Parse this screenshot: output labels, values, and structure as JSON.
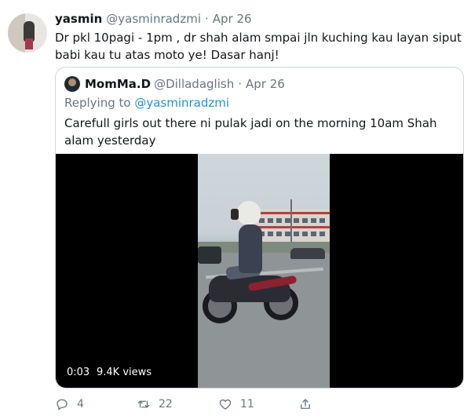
{
  "tweet": {
    "author_name": "yasmin",
    "handle": "@yasminradzmi",
    "separator": "·",
    "date": "Apr 26",
    "text": "Dr pkl 10pagi - 1pm , dr shah alam smpai jln kuching kau layan siput babi kau tu atas moto ye! Dasar hanj!"
  },
  "quoted": {
    "author_name": "MomMa.D",
    "handle": "@Dilladaglish",
    "separator": "·",
    "date": "Apr 26",
    "replying_prefix": "Replying to ",
    "replying_handle": "@yasminradzmi",
    "text": "Carefull girls out there ni pulak jadi on the morning 10am Shah alam yesterday",
    "video": {
      "duration": "0:03",
      "views": "9.4K views"
    }
  },
  "actions": {
    "reply_count": "4",
    "retweet_count": "22",
    "like_count": "11",
    "icons": [
      "reply-icon",
      "retweet-icon",
      "like-icon",
      "share-icon"
    ]
  },
  "colors": {
    "text_primary": "#14171a",
    "text_secondary": "#657786",
    "link": "#1b95e0",
    "border": "#ccd6dd"
  }
}
